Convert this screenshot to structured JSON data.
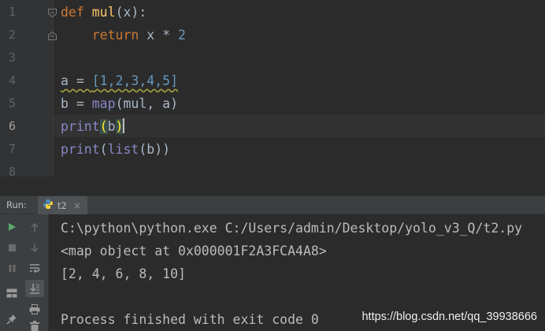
{
  "editor": {
    "line_numbers": [
      "1",
      "2",
      "3",
      "4",
      "5",
      "6",
      "7",
      "8"
    ],
    "lines": {
      "l1": {
        "kw": "def",
        "name": "mul",
        "rest": "(x):"
      },
      "l2": {
        "indent": "    ",
        "kw": "return",
        "expr": " x * ",
        "num": "2"
      },
      "l4": {
        "lhs": "a = ",
        "list": "[1,2,3,4,5]"
      },
      "l5": {
        "lhs": "b = ",
        "fn": "map",
        "args": "(mul, a)"
      },
      "l6": {
        "fn": "print",
        "open": "(",
        "arg": "b",
        "close": ")"
      },
      "l7": {
        "fn": "print",
        "open": "(",
        "inner_fn": "list",
        "rest": "(b))"
      }
    }
  },
  "run_panel": {
    "label": "Run:",
    "tab_label": "t2",
    "tab_close": "×",
    "toolbar_icons": [
      "run-icon",
      "stop-icon",
      "pause-icon",
      "layout-icon",
      "pin-icon",
      "up-arrow-icon",
      "down-arrow-icon",
      "soft-wrap-icon",
      "scroll-to-end-icon",
      "print-icon",
      "trash-icon"
    ]
  },
  "console": {
    "lines": [
      "C:\\python\\python.exe C:/Users/admin/Desktop/yolo_v3_Q/t2.py",
      "<map object at 0x000001F2A3FCA4A8>",
      "[2, 4, 6, 8, 10]",
      "",
      "Process finished with exit code 0"
    ]
  },
  "watermark": "https://blog.csdn.net/qq_39938666",
  "colors": {
    "background": "#2b2b2b",
    "keyword": "#cc7832",
    "number": "#6897bb",
    "builtin": "#8888c6",
    "function_name": "#ffc66d",
    "run_green": "#59a869"
  }
}
